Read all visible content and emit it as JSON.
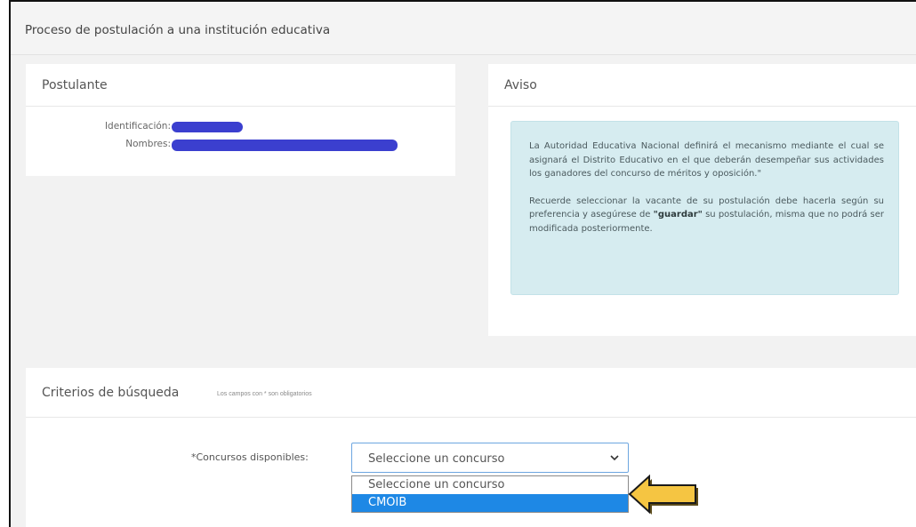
{
  "page": {
    "title": "Proceso de postulación a una institución educativa"
  },
  "postulante": {
    "title": "Postulante",
    "fields": [
      {
        "label": "Identificación:",
        "value": "redacted"
      },
      {
        "label": "Nombres:",
        "value": "redacted"
      }
    ]
  },
  "aviso": {
    "title": "Aviso",
    "paragraph1": "La Autoridad Educativa Nacional definirá el mecanismo mediante el cual se asignará el Distrito Educativo en el que deberán desempeñar sus actividades los ganadores del concurso de méritos y oposición.\"",
    "paragraph2_part1": "Recuerde seleccionar la vacante de su postulación debe hacerla según su preferencia y asegúrese de ",
    "paragraph2_bold": "\"guardar\"",
    "paragraph2_part2": " su postulación, misma que no podrá ser modificada posteriormente."
  },
  "criterios": {
    "title": "Criterios de búsqueda",
    "note": "Los campos con * son obligatorios",
    "concursos_label": "*Concursos disponibles:",
    "select_value": "Seleccione un concurso",
    "options": [
      "Seleccione un concurso",
      "CMOIB"
    ],
    "highlighted_option": "CMOIB"
  },
  "colors": {
    "accent": "#1e88e5",
    "redaction": "#3b3fcf",
    "notice_bg": "#d6ecf0",
    "arrow_fill": "#f5c542"
  },
  "icons": {
    "select_chevron": "chevron-down-icon",
    "pointer": "arrow-left-icon"
  }
}
